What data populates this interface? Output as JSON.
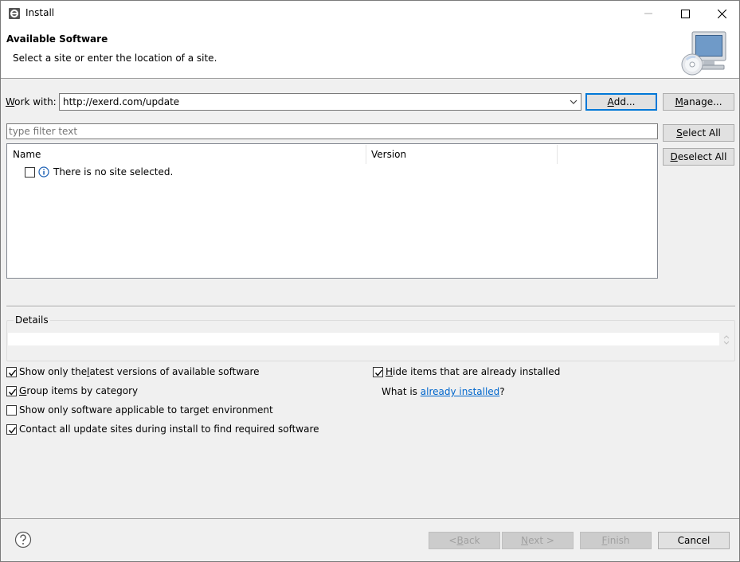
{
  "window": {
    "title": "Install"
  },
  "header": {
    "title": "Available Software",
    "subtitle": "Select a site or enter the location of a site."
  },
  "work_with": {
    "label_prefix": "W",
    "label_rest": "ork with:",
    "value": "http://exerd.com/update",
    "add_prefix": "A",
    "add_rest": "dd...",
    "manage_prefix": "M",
    "manage_rest": "anage..."
  },
  "filter": {
    "placeholder": "type filter text"
  },
  "select_all": {
    "prefix": "S",
    "rest": "elect All"
  },
  "deselect_all": {
    "prefix": "D",
    "rest": "eselect All"
  },
  "tree": {
    "columns": [
      "Name",
      "Version"
    ],
    "rows": [
      {
        "text": "There is no site selected.",
        "checked": false
      }
    ]
  },
  "details": {
    "legend": "Details"
  },
  "options": {
    "latest": {
      "pre": "Show only the ",
      "key": "l",
      "post": "atest versions of available software",
      "checked": true
    },
    "group": {
      "pre": "",
      "key": "G",
      "post": "roup items by category",
      "checked": true
    },
    "applicable": {
      "pre": "Show only software applicable to target environment",
      "key": "",
      "post": "",
      "checked": false
    },
    "contact": {
      "pre": "Contact all update sites during install to find required software",
      "key": "",
      "post": "",
      "checked": true
    },
    "hide": {
      "pre": "",
      "key": "H",
      "post": "ide items that are already installed",
      "checked": true
    },
    "whatis_pre": "What is ",
    "whatis_link": "already installed",
    "whatis_post": "?"
  },
  "footer": {
    "back": {
      "pre": "< ",
      "key": "B",
      "post": "ack"
    },
    "next": {
      "pre": "",
      "key": "N",
      "post": "ext >"
    },
    "finish": {
      "pre": "",
      "key": "F",
      "post": "inish"
    },
    "cancel": "Cancel"
  },
  "colors": {
    "accent": "#0078d7",
    "link": "#0066cc",
    "info": "#1a5fb4"
  }
}
